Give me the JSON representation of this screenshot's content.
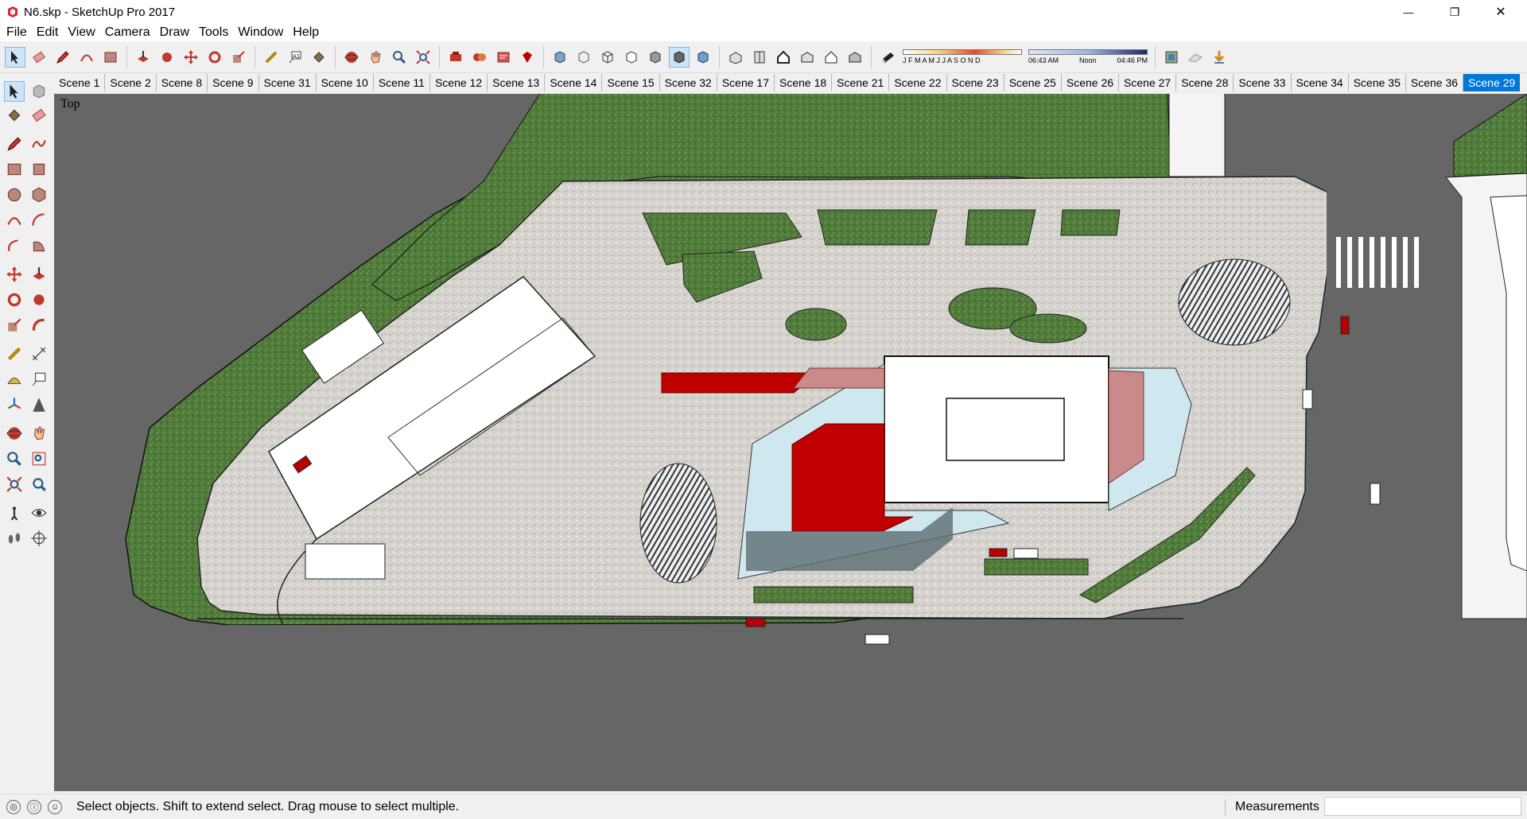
{
  "window": {
    "title": "N6.skp - SketchUp Pro 2017",
    "minimize_glyph": "—",
    "restore_glyph": "❐",
    "close_glyph": "✕"
  },
  "menu": [
    "File",
    "Edit",
    "View",
    "Camera",
    "Draw",
    "Tools",
    "Window",
    "Help"
  ],
  "shadow": {
    "months": "J F M A M J J A S O N D",
    "time_start": "06:43 AM",
    "time_mid": "Noon",
    "time_end": "04:46 PM"
  },
  "scenes": [
    "Scene 1",
    "Scene 2",
    "Scene 8",
    "Scene 9",
    "Scene 31",
    "Scene 10",
    "Scene 11",
    "Scene 12",
    "Scene 13",
    "Scene 14",
    "Scene 15",
    "Scene 32",
    "Scene 17",
    "Scene 18",
    "Scene 21",
    "Scene 22",
    "Scene 23",
    "Scene 25",
    "Scene 26",
    "Scene 27",
    "Scene 28",
    "Scene 33",
    "Scene 34",
    "Scene 35",
    "Scene 36",
    "Scene 29"
  ],
  "active_scene": "Scene 29",
  "viewport": {
    "view_name": "Top"
  },
  "status": {
    "message": "Select objects. Shift to extend select. Drag mouse to select multiple.",
    "measurements_label": "Measurements",
    "measurements_value": ""
  },
  "colors": {
    "accent": "#0078d7",
    "grass": "#4f7a3a",
    "paving": "#d8d6d2",
    "building_red": "#c00000",
    "glass": "#cfe8ef",
    "road": "#666666"
  }
}
